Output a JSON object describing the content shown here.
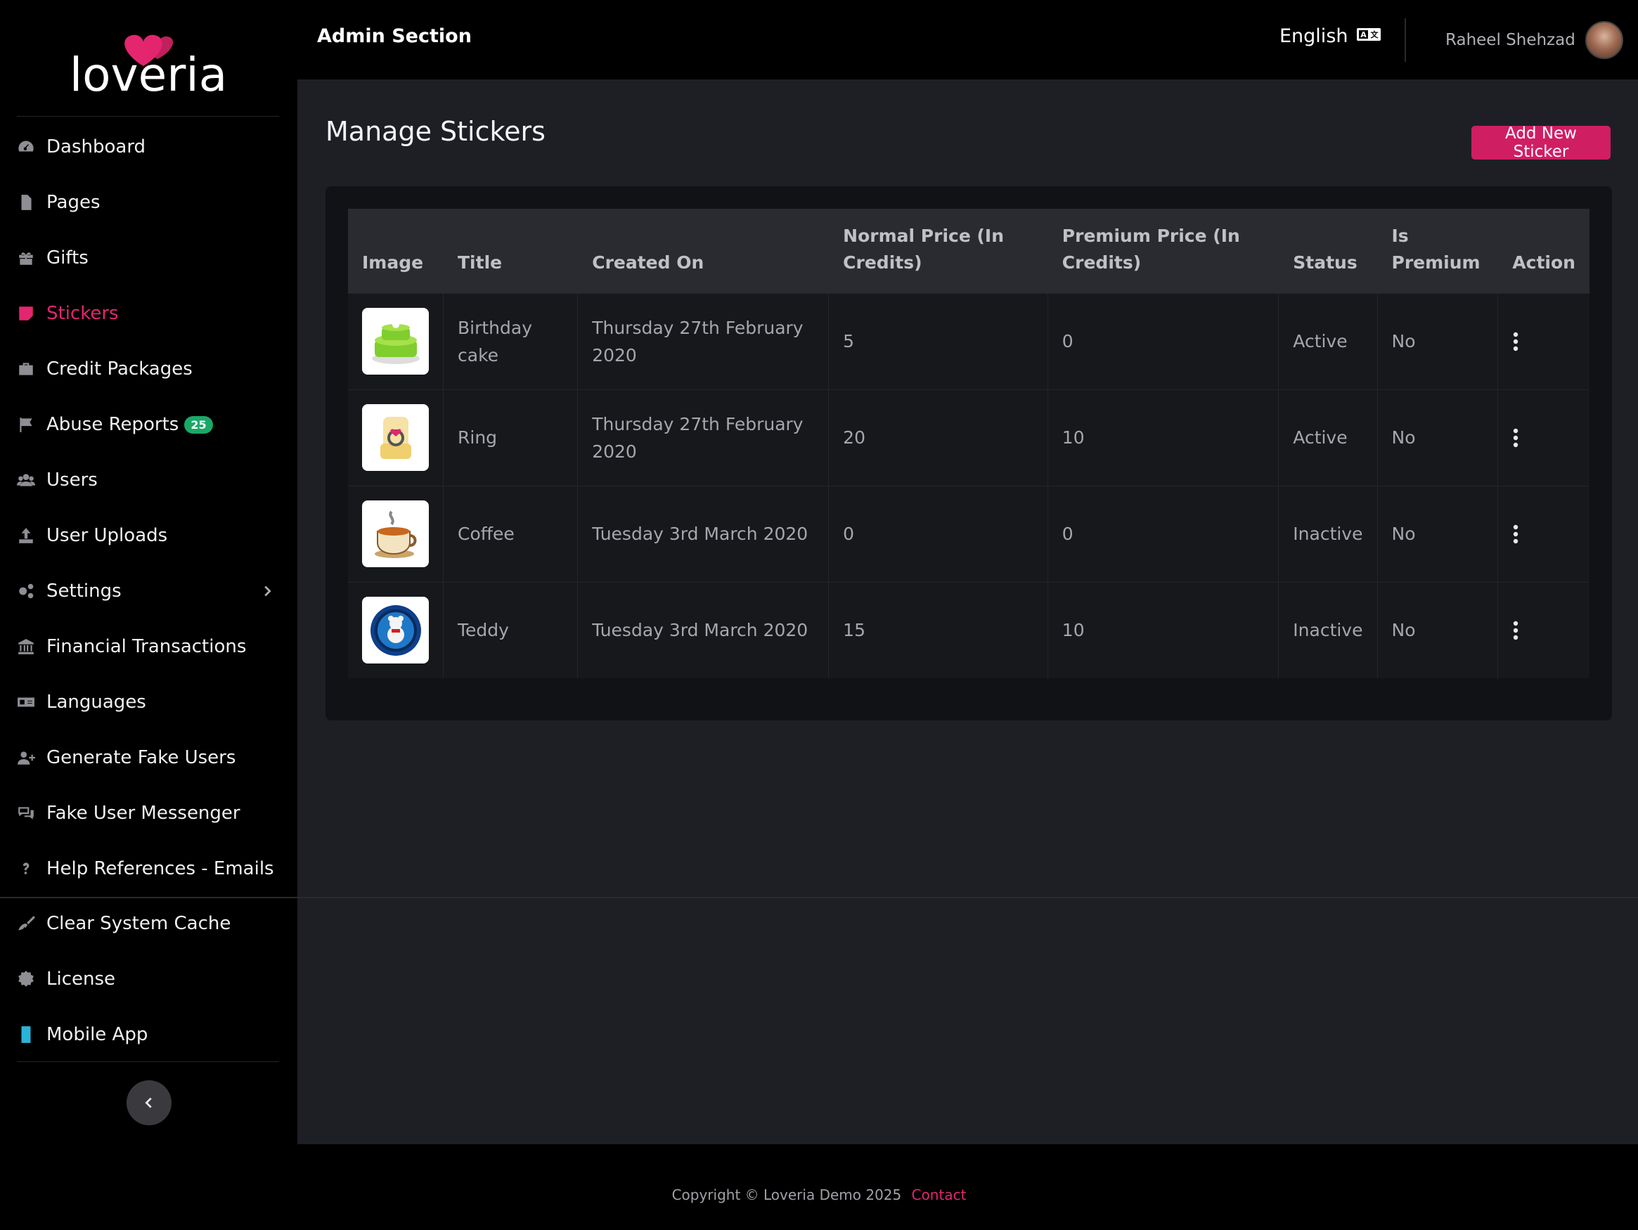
{
  "brand": {
    "name": "loveria",
    "accent": "#e3266e"
  },
  "header": {
    "title": "Admin Section",
    "language": "English",
    "user_name": "Raheel Shehzad"
  },
  "sidebar": {
    "items": [
      {
        "label": "Dashboard",
        "icon": "speedometer-icon"
      },
      {
        "label": "Pages",
        "icon": "file-icon"
      },
      {
        "label": "Gifts",
        "icon": "gift-icon"
      },
      {
        "label": "Stickers",
        "icon": "sticky-note-icon",
        "active": true
      },
      {
        "label": "Credit Packages",
        "icon": "briefcase-icon"
      },
      {
        "label": "Abuse Reports",
        "icon": "flag-icon",
        "badge": "25"
      },
      {
        "label": "Users",
        "icon": "users-icon"
      },
      {
        "label": "User Uploads",
        "icon": "upload-icon"
      },
      {
        "label": "Settings",
        "icon": "gears-icon"
      },
      {
        "label": "Financial Transactions",
        "icon": "bank-icon"
      },
      {
        "label": "Languages",
        "icon": "language-icon"
      },
      {
        "label": "Generate Fake Users",
        "icon": "user-plus-icon"
      },
      {
        "label": "Fake User Messenger",
        "icon": "comments-icon"
      },
      {
        "label": "Help References - Emails",
        "icon": "question-icon"
      },
      {
        "label": "Clear System Cache",
        "icon": "broom-icon"
      },
      {
        "label": "License",
        "icon": "certificate-icon"
      },
      {
        "label": "Mobile App",
        "icon": "mobile-icon"
      }
    ]
  },
  "main": {
    "title": "Manage Stickers",
    "add_button": "Add New Sticker",
    "table": {
      "headers": [
        "Image",
        "Title",
        "Created On",
        "Normal Price (In Credits)",
        "Premium Price (In Credits)",
        "Status",
        "Is Premium",
        "Action"
      ],
      "rows": [
        {
          "image": "birthday-cake-sticker",
          "title": "Birthday cake",
          "created": "Thursday 27th February 2020",
          "normal": "5",
          "premium": "0",
          "status": "Active",
          "is_premium": "No"
        },
        {
          "image": "ring-sticker",
          "title": "Ring",
          "created": "Thursday 27th February 2020",
          "normal": "20",
          "premium": "10",
          "status": "Active",
          "is_premium": "No"
        },
        {
          "image": "coffee-sticker",
          "title": "Coffee",
          "created": "Tuesday 3rd March 2020",
          "normal": "0",
          "premium": "0",
          "status": "Inactive",
          "is_premium": "No"
        },
        {
          "image": "teddy-sticker",
          "title": "Teddy",
          "created": "Tuesday 3rd March 2020",
          "normal": "15",
          "premium": "10",
          "status": "Inactive",
          "is_premium": "No"
        }
      ]
    }
  },
  "footer": {
    "copyright": "Copyright © Loveria Demo 2025",
    "contact": "Contact"
  }
}
